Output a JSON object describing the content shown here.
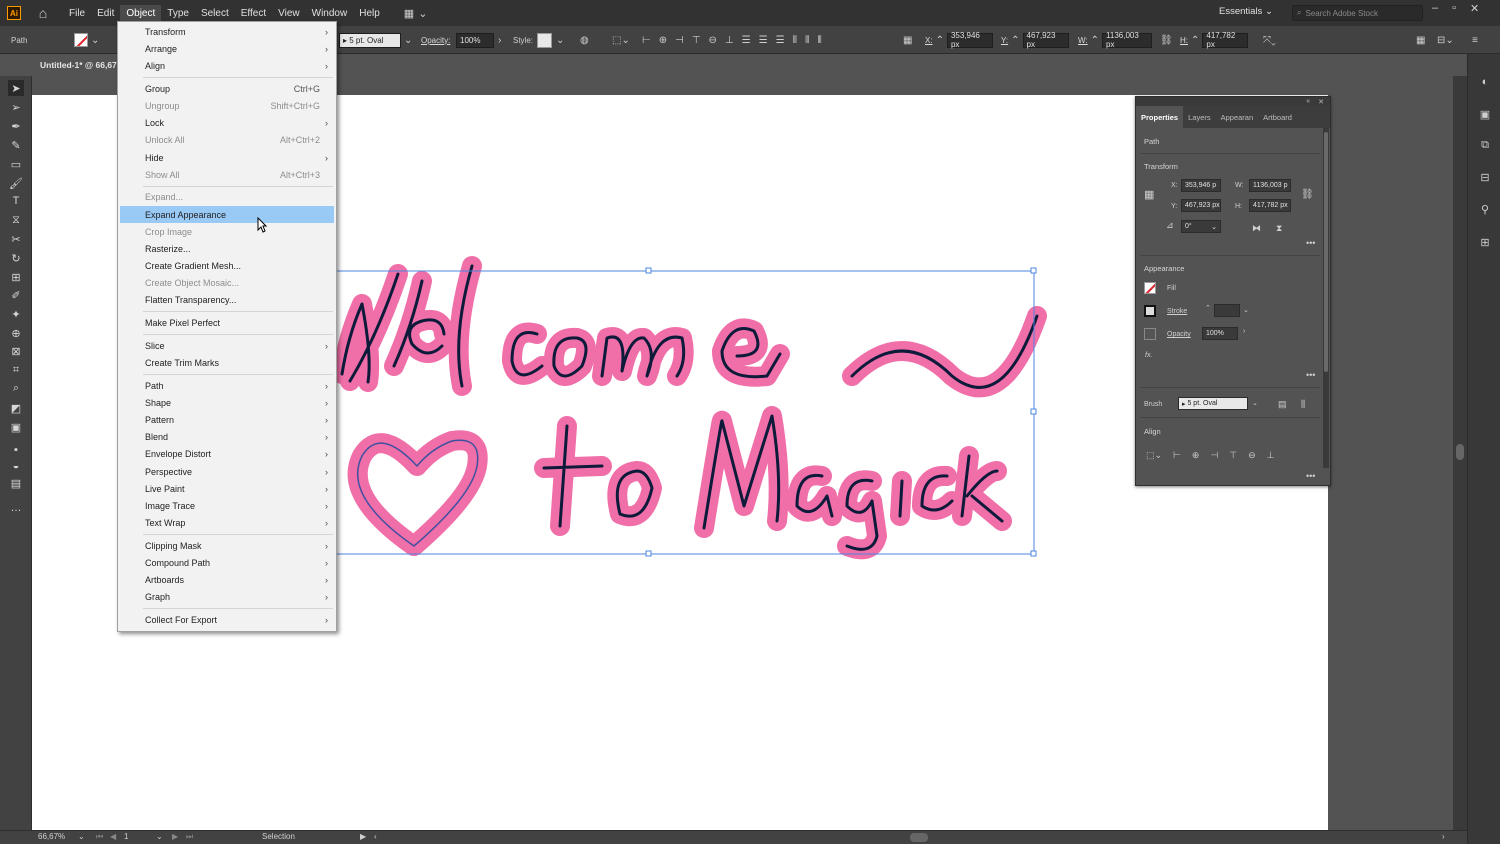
{
  "app": {
    "logo": "Ai",
    "home_icon": "home-icon"
  },
  "menubar": {
    "items": [
      "File",
      "Edit",
      "Object",
      "Type",
      "Select",
      "Effect",
      "View",
      "Window",
      "Help"
    ],
    "active": "Object",
    "workspace": "Essentials",
    "search_placeholder": "Search Adobe Stock"
  },
  "controlbar": {
    "selection_type": "Path",
    "brush": "5 pt. Oval",
    "opacity_label": "Opacity:",
    "opacity": "100%",
    "style_label": "Style:",
    "x_label": "X:",
    "x": "353,946 px",
    "y_label": "Y:",
    "y": "467,923 px",
    "w_label": "W:",
    "w": "1136,003 px",
    "h_label": "H:",
    "h": "417,782 px"
  },
  "document": {
    "tab": "Untitled-1* @ 66,67"
  },
  "object_menu": {
    "items": [
      {
        "label": "Transform",
        "submenu": true
      },
      {
        "label": "Arrange",
        "submenu": true
      },
      {
        "label": "Align",
        "submenu": true
      },
      {
        "label": "Group",
        "shortcut": "Ctrl+G"
      },
      {
        "label": "Ungroup",
        "shortcut": "Shift+Ctrl+G",
        "disabled": true
      },
      {
        "label": "Lock",
        "submenu": true
      },
      {
        "label": "Unlock All",
        "shortcut": "Alt+Ctrl+2",
        "disabled": true
      },
      {
        "label": "Hide",
        "submenu": true
      },
      {
        "label": "Show All",
        "shortcut": "Alt+Ctrl+3",
        "disabled": true
      },
      {
        "label": "Expand...",
        "disabled": true
      },
      {
        "label": "Expand Appearance",
        "highlighted": true
      },
      {
        "label": "Crop Image",
        "disabled": true
      },
      {
        "label": "Rasterize..."
      },
      {
        "label": "Create Gradient Mesh..."
      },
      {
        "label": "Create Object Mosaic...",
        "disabled": true
      },
      {
        "label": "Flatten Transparency..."
      },
      {
        "label": "Make Pixel Perfect"
      },
      {
        "label": "Slice",
        "submenu": true
      },
      {
        "label": "Create Trim Marks"
      },
      {
        "label": "Path",
        "submenu": true
      },
      {
        "label": "Shape",
        "submenu": true
      },
      {
        "label": "Pattern",
        "submenu": true
      },
      {
        "label": "Blend",
        "submenu": true
      },
      {
        "label": "Envelope Distort",
        "submenu": true
      },
      {
        "label": "Perspective",
        "submenu": true
      },
      {
        "label": "Live Paint",
        "submenu": true
      },
      {
        "label": "Image Trace",
        "submenu": true
      },
      {
        "label": "Text Wrap",
        "submenu": true
      },
      {
        "label": "Clipping Mask",
        "submenu": true
      },
      {
        "label": "Compound Path",
        "submenu": true
      },
      {
        "label": "Artboards",
        "submenu": true
      },
      {
        "label": "Graph",
        "submenu": true
      },
      {
        "label": "Collect For Export",
        "submenu": true
      }
    ]
  },
  "artwork": {
    "line1": "Welcome",
    "line2": "to Magick"
  },
  "panel": {
    "tabs": [
      "Properties",
      "Layers",
      "Appearan",
      "Artboard"
    ],
    "active_tab": "Properties",
    "object_type": "Path",
    "transform_title": "Transform",
    "x_label": "X:",
    "x": "353,946 p",
    "w_label": "W:",
    "w": "1136,003 p",
    "y_label": "Y:",
    "y": "467,923 px",
    "h_label": "H:",
    "h": "417,782 px",
    "rotate": "0°",
    "appearance_title": "Appearance",
    "fill_label": "Fill",
    "stroke_label": "Stroke",
    "opacity_label": "Opacity",
    "opacity": "100%",
    "fx_label": "fx.",
    "brush_label": "Brush",
    "brush": "5 pt. Oval",
    "align_title": "Align"
  },
  "statusbar": {
    "zoom": "66,67%",
    "artboard": "1",
    "mode": "Selection"
  },
  "colors": {
    "menu_highlight": "#99c9f5",
    "art_pink": "#f06fa8",
    "art_stroke": "#0d1a3a",
    "selection_blue": "#4d86e0"
  }
}
